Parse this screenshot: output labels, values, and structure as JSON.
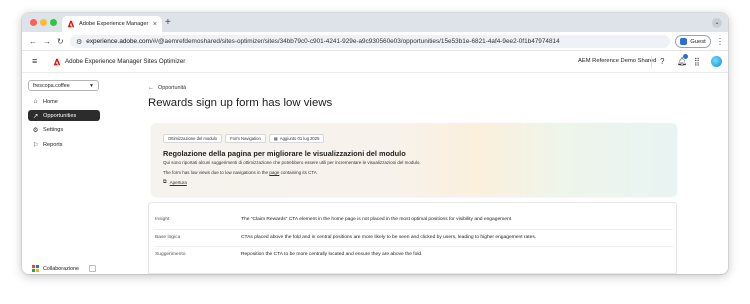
{
  "browser": {
    "tab_title": "Adobe Experience Manager S",
    "url_prefix": "experience.adobe.com",
    "url_rest": "/#/@aemrefdemoshared/sites-optimizer/sites/34bb79c0-c901-4241-929e-a9c930560e03/opportunities/15e53b1e-6821-4af4-9ee2-0f1b47974814",
    "guest_label": "Guest"
  },
  "app": {
    "title": "Adobe Experience Manager Sites Optimizer",
    "org_name": "AEM Reference Demo Shared"
  },
  "sidebar": {
    "site_select": "frescopa.coffee",
    "items": [
      {
        "label": "Home",
        "icon": "home-icon"
      },
      {
        "label": "Opportunities",
        "icon": "opportunities-icon",
        "active": true
      },
      {
        "label": "Settings",
        "icon": "gear-icon"
      },
      {
        "label": "Reports",
        "icon": "reports-icon"
      }
    ],
    "collaboration": "Collaborazione"
  },
  "main": {
    "back_label": "Opportunità",
    "page_title": "Rewards sign up form has low views",
    "hero": {
      "chips": [
        "Ottimizzazione del modulo",
        "Form Navigation",
        "Aggiunto 01 lug 2025"
      ],
      "title": "Regolazione della pagina per migliorare le visualizzazioni del modulo",
      "subtitle": "Qui sono riportati alcuni suggerimenti di ottimizzazione che potrebbero essere utili per incrementare le visualizzazioni del modulo.",
      "note_before": "The form has low views due to low navigations in the ",
      "note_link": "page",
      "note_after": " containing its CTA",
      "link_label": "Apertura"
    },
    "details": [
      {
        "label": "Insight",
        "value": "The \"Claim Rewards\" CTA element in the home page is not placed in the most optimal positions for visibility and engagement"
      },
      {
        "label": "Base logica",
        "value": "CTAs placed above the fold and in central positions are more likely to be seen and clicked by users, leading to higher engagement rates."
      },
      {
        "label": "Suggerimento",
        "value": "Reposition the CTA to be more centrally located and ensure they are above the fold."
      }
    ]
  },
  "colors": {
    "adobe_red": "#eb1000",
    "active_nav": "#2c2c2c",
    "accent_blue": "#2b6fd6"
  }
}
